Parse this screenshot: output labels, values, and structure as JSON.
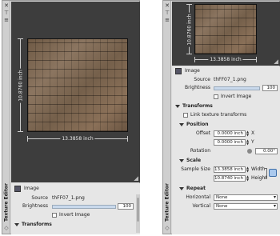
{
  "panel_title": "Texture Editor",
  "viewport": {
    "width_label": "13.3858 inch",
    "height_label": "10.8760 inch"
  },
  "image_section": {
    "header": "Image",
    "source_label": "Source",
    "source_value": "thFF07_1.png",
    "brightness_label": "Brightness",
    "brightness_value": "100",
    "invert_label": "Invert Image",
    "invert_checked": false
  },
  "transforms": {
    "header": "Transforms",
    "link_label": "Link texture transforms"
  },
  "position": {
    "header": "Position",
    "offset_label": "Offset",
    "offset_x": "0.0000 inch",
    "offset_y": "0.0000 inch",
    "x_label": "X",
    "y_label": "Y",
    "rotation_label": "Rotation",
    "rotation_value": "0.00°"
  },
  "scale": {
    "header": "Scale",
    "sample_size_label": "Sample Size",
    "width_value": "13.3858 inch",
    "height_value": "10.8740 inch",
    "width_label": "Width",
    "height_label": "Height"
  },
  "repeat": {
    "header": "Repeat",
    "horizontal_label": "Horizontal",
    "horizontal_value": "None",
    "vertical_label": "Vertical",
    "vertical_value": "None"
  }
}
